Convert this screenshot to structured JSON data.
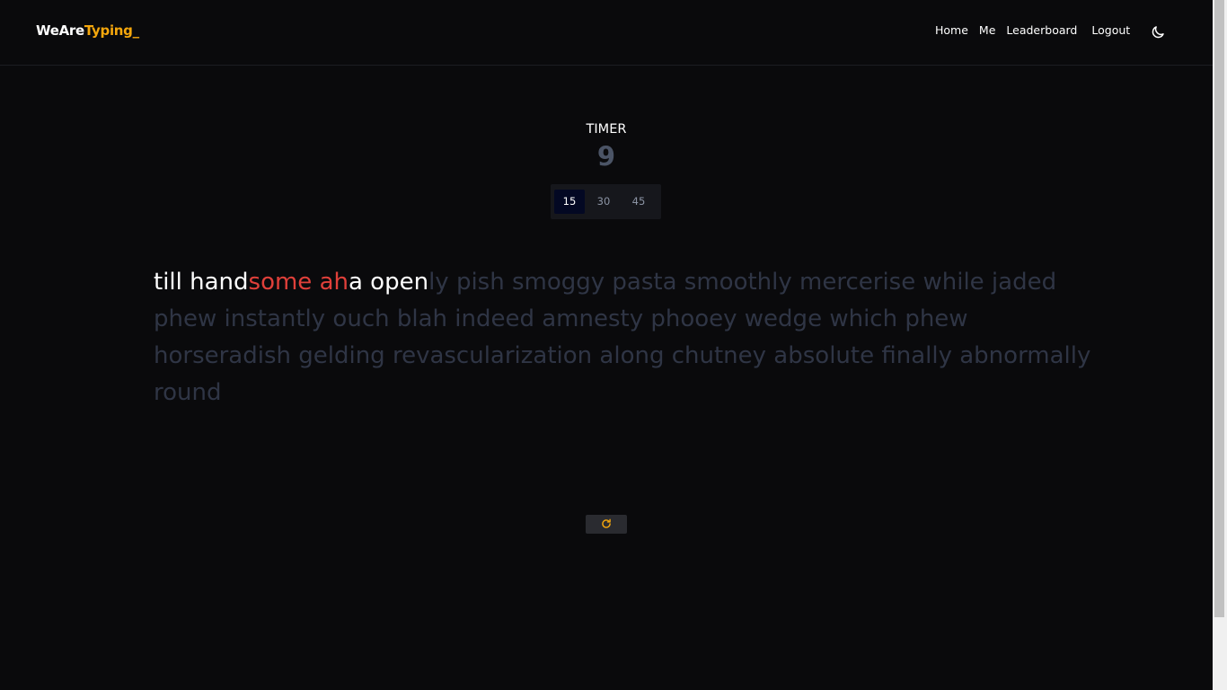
{
  "header": {
    "logo_main": "WeAre",
    "logo_accent": "Typing_",
    "nav": {
      "home": "Home",
      "me": "Me",
      "leaderboard": "Leaderboard",
      "logout": "Logout"
    },
    "theme_icon": "moon-icon"
  },
  "timer": {
    "label": "TIMER",
    "value": "9",
    "durations": [
      "15",
      "30",
      "45"
    ],
    "selected": "15"
  },
  "text": {
    "typed_correct_1": "till hand",
    "typed_wrong": "some ah",
    "typed_correct_2": "a open",
    "remaining": "ly pish smoggy pasta smoothly mercerise while jaded phew instantly ouch blah indeed amnesty phooey wedge which phew horseradish gelding revascularization along chutney absolute finally abnormally round"
  },
  "restart": {
    "icon": "refresh-icon"
  },
  "colors": {
    "accent": "#f5a70c",
    "error": "#e0403a",
    "untyped": "#2f3545",
    "background": "#0a0a0c"
  }
}
